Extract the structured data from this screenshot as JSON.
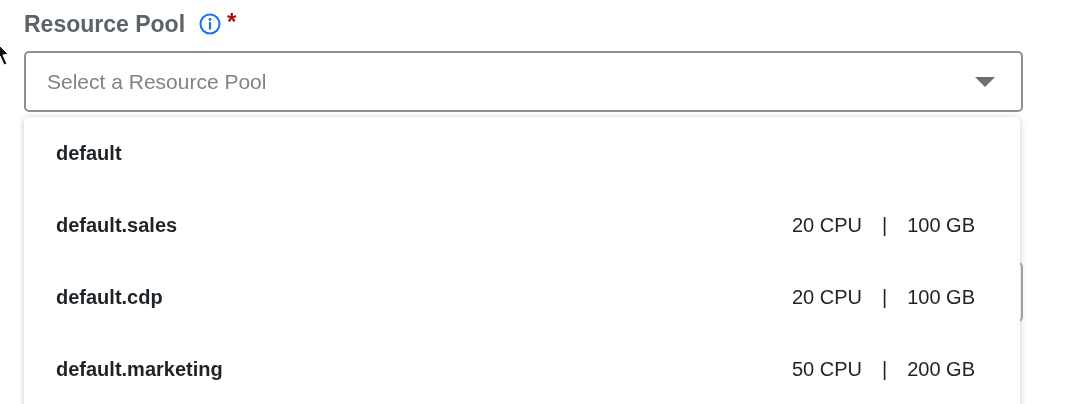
{
  "field": {
    "label": "Resource Pool",
    "required_mark": "*",
    "placeholder": "Select a Resource Pool"
  },
  "options": [
    {
      "name": "default"
    },
    {
      "name": "default.sales",
      "cpu": "20 CPU",
      "separator": "|",
      "memory": "100 GB"
    },
    {
      "name": "default.cdp",
      "cpu": "20 CPU",
      "separator": "|",
      "memory": "100 GB"
    },
    {
      "name": "default.marketing",
      "cpu": "50 CPU",
      "separator": "|",
      "memory": "200 GB"
    }
  ]
}
